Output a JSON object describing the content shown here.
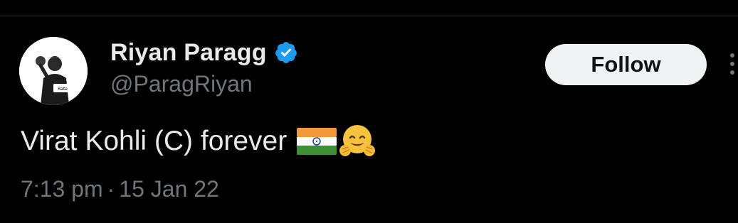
{
  "tweet": {
    "author": {
      "display_name": "Riyan Paragg",
      "handle": "@ParagRiyan",
      "verified": true,
      "verified_icon": "verified-badge-icon",
      "avatar_icon": "cricketer-avatar-icon"
    },
    "follow_label": "Follow",
    "more_icon": "more-vertical-icon",
    "text": "Virat Kohli (C) forever",
    "emojis": [
      "india-flag-icon",
      "hugging-face-icon"
    ],
    "time": "7:13 pm",
    "separator": "·",
    "date": "15 Jan 22"
  },
  "colors": {
    "background": "#000000",
    "text_primary": "#e7e9ea",
    "text_secondary": "#71767b",
    "verified_blue": "#1d9bf0",
    "follow_bg": "#eff3f4",
    "divider": "#2f3336"
  }
}
